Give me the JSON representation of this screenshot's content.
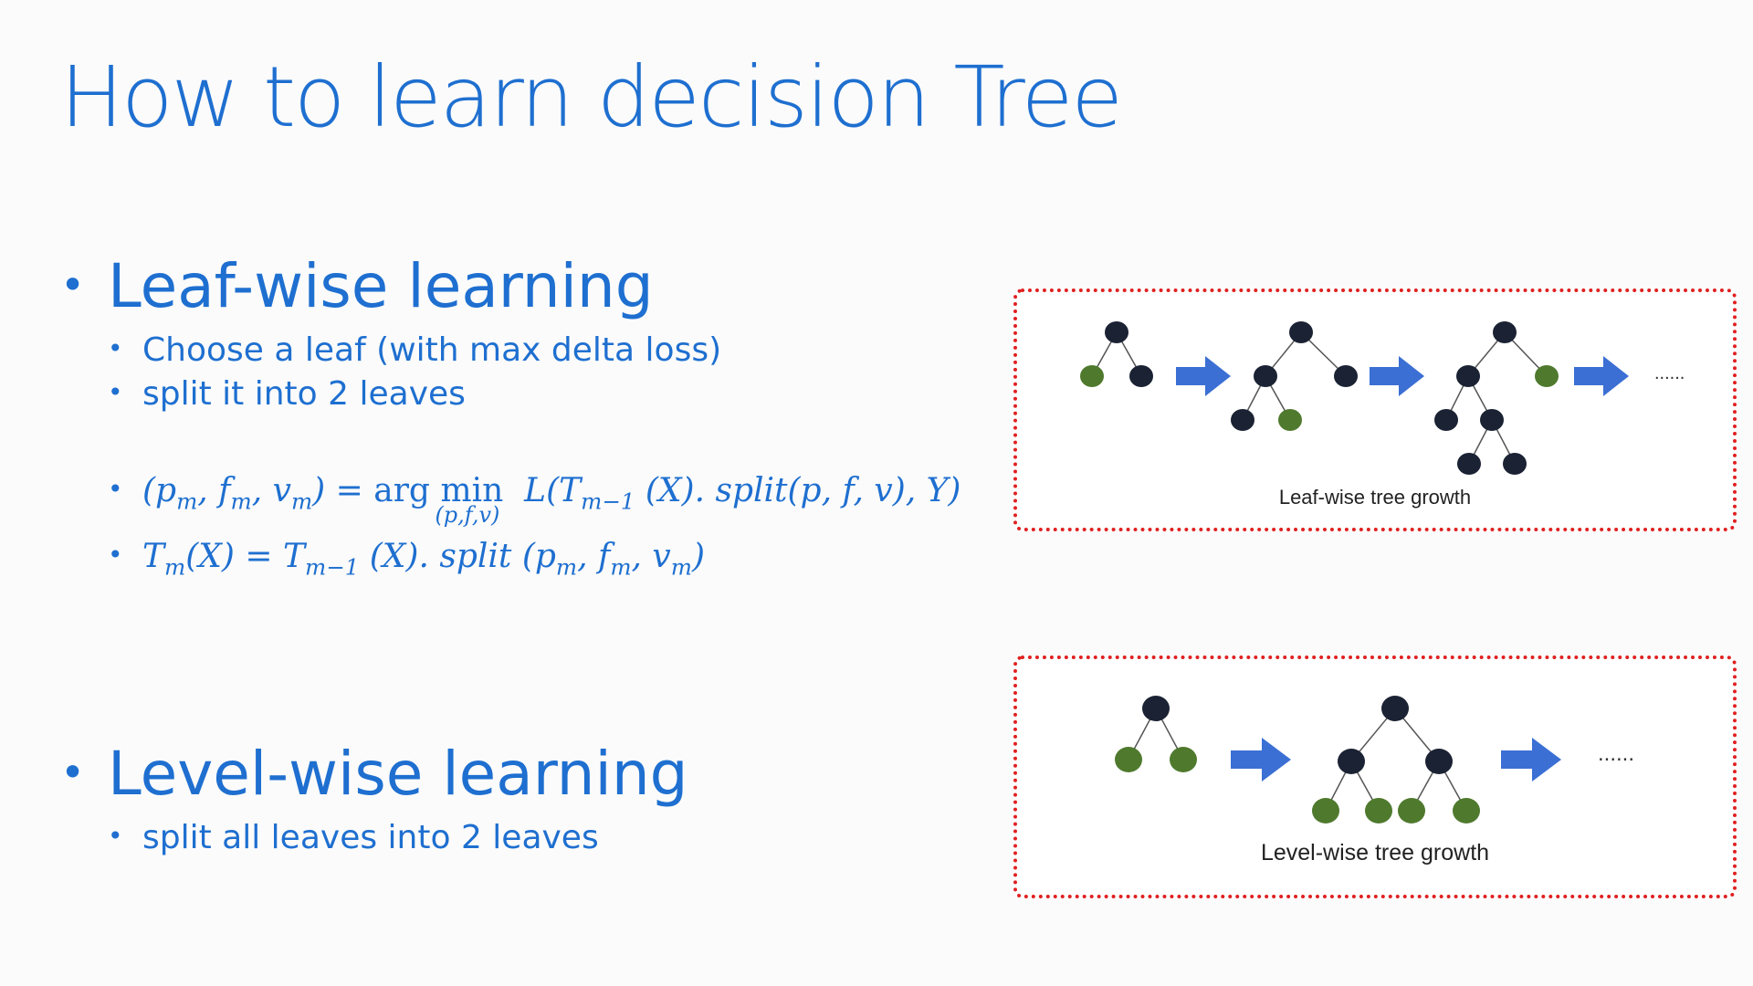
{
  "slide": {
    "title": "How to learn decision Tree",
    "leaf_wise": {
      "heading": "Leaf-wise learning",
      "points": [
        "Choose a leaf (with max delta loss)",
        "split it into 2 leaves"
      ],
      "formulas": {
        "f1_lhs": "(p",
        "f1_text": "(pm, fm, vm) = arg min(p,f,v) L(Tm−1 (X). split(p, f, v), Y)",
        "f2_text": "Tm(X) = Tm−1 (X). split (pm, fm, vm)"
      }
    },
    "level_wise": {
      "heading": "Level-wise learning",
      "points": [
        "split all leaves into 2 leaves"
      ]
    }
  },
  "diagrams": {
    "leaf_wise": {
      "caption": "Leaf-wise tree growth",
      "ellipsis": "......"
    },
    "level_wise": {
      "caption": "Level-wise tree growth",
      "ellipsis": "......"
    },
    "colors": {
      "node_dark": "#1a2233",
      "node_leaf": "#4f7a2e",
      "arrow": "#3b6fd4",
      "border": "#e02020"
    }
  }
}
